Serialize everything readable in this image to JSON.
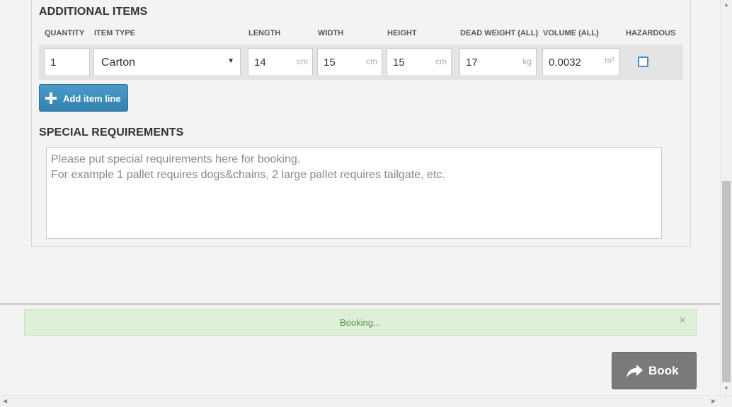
{
  "additional_items": {
    "title": "ADDITIONAL ITEMS",
    "columns": {
      "quantity": "QUANTITY",
      "item_type": "ITEM TYPE",
      "length": "LENGTH",
      "width": "WIDTH",
      "height": "HEIGHT",
      "dead_weight": "DEAD WEIGHT (ALL)",
      "volume": "VOLUME (ALL)",
      "hazardous": "HAZARDOUS"
    },
    "row": {
      "quantity": "1",
      "item_type": "Carton",
      "length": "14",
      "length_unit": "cm",
      "width": "15",
      "width_unit": "cm",
      "height": "15",
      "height_unit": "cm",
      "dead_weight": "17",
      "dead_weight_unit": "kg",
      "volume": "0.0032",
      "volume_unit": "m³",
      "hazardous_checked": false
    },
    "add_button_label": "Add item line"
  },
  "special_requirements": {
    "title": "SPECIAL REQUIREMENTS",
    "placeholder_line1": "Please put special requirements here for booking.",
    "placeholder_line2": "For example 1 pallet requires dogs&chains, 2 large pallet requires tailgate, etc."
  },
  "status": {
    "message": "Booking...",
    "close_glyph": "×"
  },
  "actions": {
    "book_label": "Book"
  },
  "icons": {
    "plus": "plus-icon",
    "share_arrow": "share-arrow-icon",
    "dropdown_caret": "▼"
  },
  "colors": {
    "primary_button": "#3e8dbd",
    "book_button": "#7a7a7a",
    "alert_bg": "#dff0d8",
    "alert_text": "#5a8a4e"
  }
}
